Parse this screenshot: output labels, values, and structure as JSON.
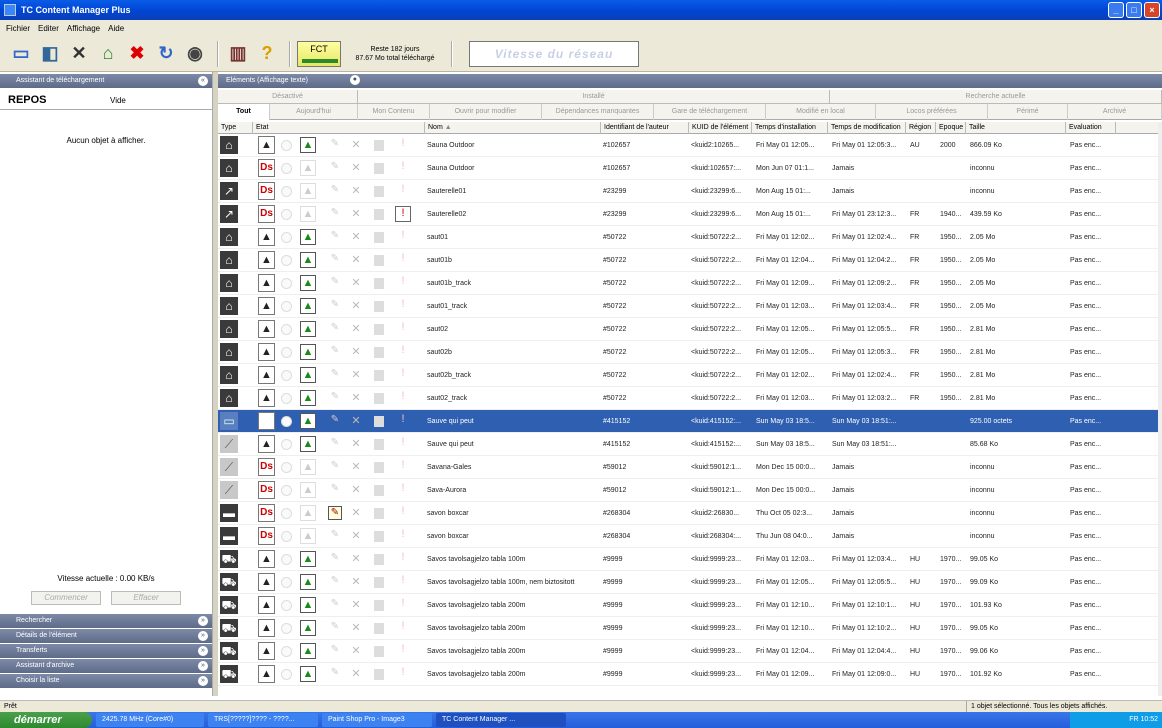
{
  "window": {
    "title": "TC Content Manager Plus"
  },
  "menu": [
    "Fichier",
    "Editer",
    "Affichage",
    "Aide"
  ],
  "toolbar": {
    "fct_label": "FCT",
    "quota_days": "Reste 182 jours",
    "quota_total": "87.67 Mo total téléchargé",
    "network_speed": "Vitesse du réseau"
  },
  "left": {
    "panel_title": "Assistant de téléchargement",
    "repos_label": "REPOS",
    "repos_value": "Vide",
    "empty_message": "Aucun objet à afficher.",
    "speed": "Vitesse actuelle : 0.00 KB/s",
    "start_button": "Commencer",
    "clear_button": "Effacer",
    "accordion": [
      "Rechercher",
      "Détails de l'élément",
      "Transferts",
      "Assistant d'archive",
      "Choisir la liste"
    ]
  },
  "right": {
    "panel_title": "Eléments (Affichage texte)",
    "groups": [
      "Désactivé",
      "Installé",
      "Recherche actuelle"
    ],
    "tabs": [
      "Tout",
      "Aujourd'hui",
      "Mon Contenu",
      "Ouvrir pour modifier",
      "Dépendances manquantes",
      "Gare de téléchargement",
      "Modifié en local",
      "Locos préférées",
      "Périmé",
      "Archivé"
    ],
    "columns": [
      "Type",
      "Etat",
      "Nom",
      "Identifiant de l'auteur",
      "KUID de l'élément",
      "Temps d'installation",
      "Temps de modification",
      "Région",
      "Epoque",
      "Taille",
      "Evaluation"
    ]
  },
  "rows": [
    {
      "type": "⌂",
      "tl": 0,
      "st": "▲",
      "ds": 0,
      "tri": 1,
      "pin": 0,
      "wr": 0,
      "name": "Sauna Outdoor",
      "author": "#102657",
      "kuid": "<kuid2:10265...",
      "inst": "Fri May 01 12:05...",
      "mod": "Fri May 01 12:05:3...",
      "region": "AU",
      "epoch": "2000",
      "size": "866.09 Ko",
      "eval": "Pas enc..."
    },
    {
      "type": "⌂",
      "tl": 0,
      "st": "Ds",
      "ds": 1,
      "tri": 0,
      "pin": 0,
      "wr": 0,
      "name": "Sauna Outdoor",
      "author": "#102657",
      "kuid": "<kuid:102657:...",
      "inst": "Mon Jun 07 01:1...",
      "mod": "Jamais",
      "region": "",
      "epoch": "",
      "size": "inconnu",
      "eval": "Pas enc..."
    },
    {
      "type": "↗",
      "tl": 0,
      "st": "Ds",
      "ds": 1,
      "tri": 0,
      "pin": 0,
      "wr": 0,
      "name": "Sauterelle01",
      "author": "#23299",
      "kuid": "<kuid:23299:6...",
      "inst": "Mon Aug 15 01:...",
      "mod": "Jamais",
      "region": "",
      "epoch": "",
      "size": "inconnu",
      "eval": "Pas enc..."
    },
    {
      "type": "↗",
      "tl": 0,
      "st": "Ds",
      "ds": 1,
      "tri": 0,
      "pin": 0,
      "wr": 1,
      "name": "Sauterelle02",
      "author": "#23299",
      "kuid": "<kuid:23299:6...",
      "inst": "Mon Aug 15 01:...",
      "mod": "Fri May 01 23:12:3...",
      "region": "FR",
      "epoch": "1940...",
      "size": "439.59 Ko",
      "eval": "Pas enc..."
    },
    {
      "type": "⌂",
      "tl": 0,
      "st": "▲",
      "ds": 0,
      "tri": 1,
      "pin": 0,
      "wr": 0,
      "name": "saut01",
      "author": "#50722",
      "kuid": "<kuid:50722:2...",
      "inst": "Fri May 01 12:02...",
      "mod": "Fri May 01 12:02:4...",
      "region": "FR",
      "epoch": "1950...",
      "size": "2.05 Mo",
      "eval": "Pas enc..."
    },
    {
      "type": "⌂",
      "tl": 0,
      "st": "▲",
      "ds": 0,
      "tri": 1,
      "pin": 0,
      "wr": 0,
      "name": "saut01b",
      "author": "#50722",
      "kuid": "<kuid:50722:2...",
      "inst": "Fri May 01 12:04...",
      "mod": "Fri May 01 12:04:2...",
      "region": "FR",
      "epoch": "1950...",
      "size": "2.05 Mo",
      "eval": "Pas enc..."
    },
    {
      "type": "⌂",
      "tl": 0,
      "st": "▲",
      "ds": 0,
      "tri": 1,
      "pin": 0,
      "wr": 0,
      "name": "saut01b_track",
      "author": "#50722",
      "kuid": "<kuid:50722:2...",
      "inst": "Fri May 01 12:09...",
      "mod": "Fri May 01 12:09:2...",
      "region": "FR",
      "epoch": "1950...",
      "size": "2.05 Mo",
      "eval": "Pas enc..."
    },
    {
      "type": "⌂",
      "tl": 0,
      "st": "▲",
      "ds": 0,
      "tri": 1,
      "pin": 0,
      "wr": 0,
      "name": "saut01_track",
      "author": "#50722",
      "kuid": "<kuid:50722:2...",
      "inst": "Fri May 01 12:03...",
      "mod": "Fri May 01 12:03:4...",
      "region": "FR",
      "epoch": "1950...",
      "size": "2.05 Mo",
      "eval": "Pas enc..."
    },
    {
      "type": "⌂",
      "tl": 0,
      "st": "▲",
      "ds": 0,
      "tri": 1,
      "pin": 0,
      "wr": 0,
      "name": "saut02",
      "author": "#50722",
      "kuid": "<kuid:50722:2...",
      "inst": "Fri May 01 12:05...",
      "mod": "Fri May 01 12:05:5...",
      "region": "FR",
      "epoch": "1950...",
      "size": "2.81 Mo",
      "eval": "Pas enc..."
    },
    {
      "type": "⌂",
      "tl": 0,
      "st": "▲",
      "ds": 0,
      "tri": 1,
      "pin": 0,
      "wr": 0,
      "name": "saut02b",
      "author": "#50722",
      "kuid": "<kuid:50722:2...",
      "inst": "Fri May 01 12:05...",
      "mod": "Fri May 01 12:05:3...",
      "region": "FR",
      "epoch": "1950...",
      "size": "2.81 Mo",
      "eval": "Pas enc..."
    },
    {
      "type": "⌂",
      "tl": 0,
      "st": "▲",
      "ds": 0,
      "tri": 1,
      "pin": 0,
      "wr": 0,
      "name": "saut02b_track",
      "author": "#50722",
      "kuid": "<kuid:50722:2...",
      "inst": "Fri May 01 12:02...",
      "mod": "Fri May 01 12:02:4...",
      "region": "FR",
      "epoch": "1950...",
      "size": "2.81 Mo",
      "eval": "Pas enc..."
    },
    {
      "type": "⌂",
      "tl": 0,
      "st": "▲",
      "ds": 0,
      "tri": 1,
      "pin": 0,
      "wr": 0,
      "name": "saut02_track",
      "author": "#50722",
      "kuid": "<kuid:50722:2...",
      "inst": "Fri May 01 12:03...",
      "mod": "Fri May 01 12:03:2...",
      "region": "FR",
      "epoch": "1950...",
      "size": "2.81 Mo",
      "eval": "Pas enc..."
    },
    {
      "type": "▭",
      "tl": 2,
      "st": "▲",
      "ds": 0,
      "tri": 1,
      "pin": 0,
      "wr": 0,
      "sel": 1,
      "name": "Sauve qui peut",
      "author": "#415152",
      "kuid": "<kuid:415152:...",
      "inst": "Sun May 03 18:5...",
      "mod": "Sun May 03 18:51:...",
      "region": "",
      "epoch": "",
      "size": "925.00 octets",
      "eval": "Pas enc..."
    },
    {
      "type": "⟋",
      "tl": 1,
      "st": "▲",
      "ds": 0,
      "tri": 1,
      "pin": 0,
      "wr": 0,
      "name": "Sauve qui peut",
      "author": "#415152",
      "kuid": "<kuid:415152:...",
      "inst": "Sun May 03 18:5...",
      "mod": "Sun May 03 18:51:...",
      "region": "",
      "epoch": "",
      "size": "85.68 Ko",
      "eval": "Pas enc..."
    },
    {
      "type": "⟋",
      "tl": 1,
      "st": "Ds",
      "ds": 1,
      "tri": 0,
      "pin": 0,
      "wr": 0,
      "name": "Savana-Gales",
      "author": "#59012",
      "kuid": "<kuid:59012:1...",
      "inst": "Mon Dec 15 00:0...",
      "mod": "Jamais",
      "region": "",
      "epoch": "",
      "size": "inconnu",
      "eval": "Pas enc..."
    },
    {
      "type": "⟋",
      "tl": 1,
      "st": "Ds",
      "ds": 1,
      "tri": 0,
      "pin": 0,
      "wr": 0,
      "name": "Sava-Aurora",
      "author": "#59012",
      "kuid": "<kuid:59012:1...",
      "inst": "Mon Dec 15 00:0...",
      "mod": "Jamais",
      "region": "",
      "epoch": "",
      "size": "inconnu",
      "eval": "Pas enc..."
    },
    {
      "type": "▬",
      "tl": 0,
      "st": "Ds",
      "ds": 1,
      "tri": 0,
      "pin": 1,
      "wr": 0,
      "name": "savon boxcar",
      "author": "#268304",
      "kuid": "<kuid2:26830...",
      "inst": "Thu Oct 05 02:3...",
      "mod": "Jamais",
      "region": "",
      "epoch": "",
      "size": "inconnu",
      "eval": "Pas enc..."
    },
    {
      "type": "▬",
      "tl": 0,
      "st": "Ds",
      "ds": 1,
      "tri": 0,
      "pin": 0,
      "wr": 0,
      "name": "savon boxcar",
      "author": "#268304",
      "kuid": "<kuid:268304:...",
      "inst": "Thu Jun 08 04:0...",
      "mod": "Jamais",
      "region": "",
      "epoch": "",
      "size": "inconnu",
      "eval": "Pas enc..."
    },
    {
      "type": "⛟",
      "tl": 0,
      "st": "▲",
      "ds": 0,
      "tri": 1,
      "pin": 0,
      "wr": 0,
      "name": "Savos tavolsagjelzo tabla 100m",
      "author": "#9999",
      "kuid": "<kuid:9999:23...",
      "inst": "Fri May 01 12:03...",
      "mod": "Fri May 01 12:03:4...",
      "region": "HU",
      "epoch": "1970...",
      "size": "99.05 Ko",
      "eval": "Pas enc..."
    },
    {
      "type": "⛟",
      "tl": 0,
      "st": "▲",
      "ds": 0,
      "tri": 1,
      "pin": 0,
      "wr": 0,
      "name": "Savos tavolsagjelzo tabla 100m, nem biztositott",
      "author": "#9999",
      "kuid": "<kuid:9999:23...",
      "inst": "Fri May 01 12:05...",
      "mod": "Fri May 01 12:05:5...",
      "region": "HU",
      "epoch": "1970...",
      "size": "99.09 Ko",
      "eval": "Pas enc..."
    },
    {
      "type": "⛟",
      "tl": 0,
      "st": "▲",
      "ds": 0,
      "tri": 1,
      "pin": 0,
      "wr": 0,
      "name": "Savos tavolsagjelzo tabla 200m",
      "author": "#9999",
      "kuid": "<kuid:9999:23...",
      "inst": "Fri May 01 12:10...",
      "mod": "Fri May 01 12:10:1...",
      "region": "HU",
      "epoch": "1970...",
      "size": "101.93 Ko",
      "eval": "Pas enc..."
    },
    {
      "type": "⛟",
      "tl": 0,
      "st": "▲",
      "ds": 0,
      "tri": 1,
      "pin": 0,
      "wr": 0,
      "name": "Savos tavolsagjelzo tabla 200m",
      "author": "#9999",
      "kuid": "<kuid:9999:23...",
      "inst": "Fri May 01 12:10...",
      "mod": "Fri May 01 12:10:2...",
      "region": "HU",
      "epoch": "1970...",
      "size": "99.05 Ko",
      "eval": "Pas enc..."
    },
    {
      "type": "⛟",
      "tl": 0,
      "st": "▲",
      "ds": 0,
      "tri": 1,
      "pin": 0,
      "wr": 0,
      "name": "Savos tavolsagjelzo tabla 200m",
      "author": "#9999",
      "kuid": "<kuid:9999:23...",
      "inst": "Fri May 01 12:04...",
      "mod": "Fri May 01 12:04:4...",
      "region": "HU",
      "epoch": "1970...",
      "size": "99.06 Ko",
      "eval": "Pas enc..."
    },
    {
      "type": "⛟",
      "tl": 0,
      "st": "▲",
      "ds": 0,
      "tri": 1,
      "pin": 0,
      "wr": 0,
      "name": "Savos tavolsagjelzo tabla 200m",
      "author": "#9999",
      "kuid": "<kuid:9999:23...",
      "inst": "Fri May 01 12:09...",
      "mod": "Fri May 01 12:09:0...",
      "region": "HU",
      "epoch": "1970...",
      "size": "101.92 Ko",
      "eval": "Pas enc..."
    }
  ],
  "status": {
    "left": "Prêt",
    "right": "1 objet sélectionné. Tous les objets affichés."
  },
  "taskbar": {
    "start": "démarrer",
    "tasks": [
      "2425.78 MHz (Core#0)",
      "TRS[?????]???? - ????...",
      "Paint Shop Pro - Image3",
      "TC Content Manager ..."
    ],
    "tray": "FR  10:52"
  }
}
